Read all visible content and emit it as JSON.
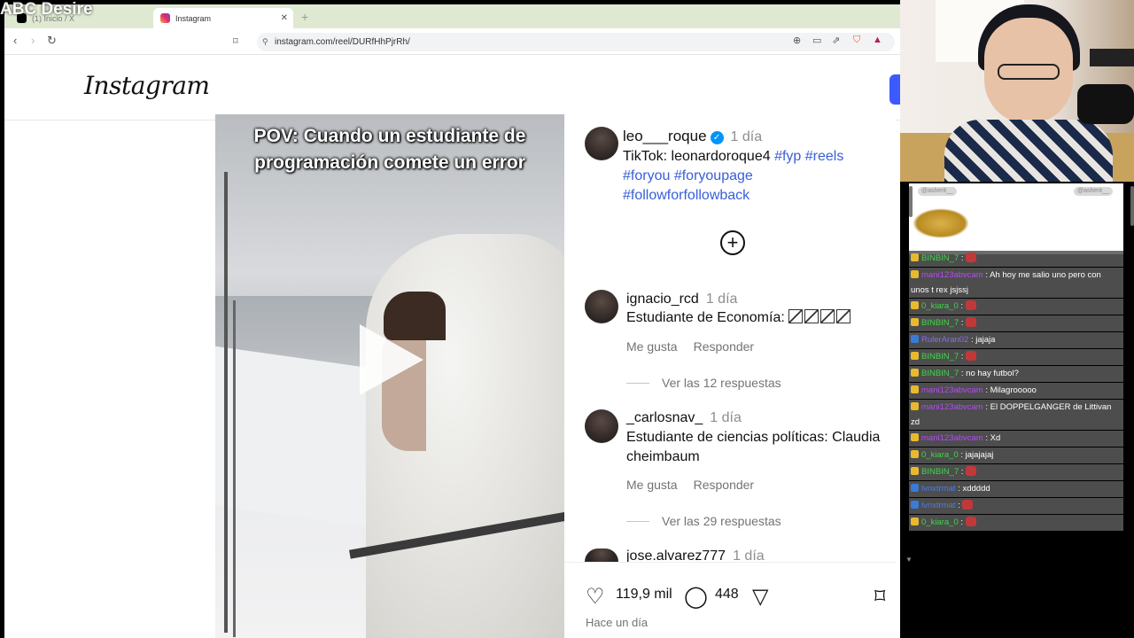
{
  "stream": {
    "overlay_title": "ABC Desire"
  },
  "browser": {
    "tabs": [
      {
        "label": "(1) Inicio / X",
        "active": false
      },
      {
        "label": "Instagram",
        "active": true
      }
    ],
    "url": "instagram.com/reel/DURfHhPjrRh/"
  },
  "instagram": {
    "logo": "Instagram",
    "video": {
      "caption": "POV: Cuando un estudiante de programación comete un error"
    },
    "post": {
      "username": "leo___roque",
      "time": "1 día",
      "caption_text": "TikTok: leonardoroque4 ",
      "hashtags": [
        "#fyp",
        "#reels",
        "#foryou",
        "#foryoupage",
        "#followforfollowback"
      ]
    },
    "comments": [
      {
        "username": "ignacio_rcd",
        "time": "1 día",
        "text": "Estudiante de Economía: ",
        "emoji_count": 4,
        "like_label": "Me gusta",
        "reply_label": "Responder",
        "replies_label": "Ver las 12 respuestas"
      },
      {
        "username": "_carlosnav_",
        "time": "1 día",
        "text": "Estudiante de ciencias políticas: Claudia cheimbaum",
        "like_label": "Me gusta",
        "reply_label": "Responder",
        "replies_label": "Ver las 29 respuestas"
      },
      {
        "username": "jose.alvarez777",
        "time": "1 día"
      }
    ],
    "actions": {
      "likes": "119,9 mil",
      "comments": "448",
      "posted": "Hace un día"
    }
  },
  "chat": {
    "header_pills": [
      "@asherit__",
      "@asherit__"
    ],
    "messages": [
      {
        "user": "BINBIN_7",
        "text": "",
        "color": "#3fd64a",
        "badge": "gold",
        "emote": true
      },
      {
        "user": "mani123abvcam",
        "text": "Ah hoy me salio uno pero con unos t rex jsjssj",
        "color": "#b34df2",
        "badge": "gold"
      },
      {
        "user": "0_kiara_0",
        "text": "",
        "color": "#3fd64a",
        "badge": "gold",
        "emote": true
      },
      {
        "user": "BINBIN_7",
        "text": "",
        "color": "#3fd64a",
        "badge": "gold",
        "emote": true
      },
      {
        "user": "RulerAran02",
        "text": "jajaja",
        "color": "#8a6cf0",
        "badge": "blue"
      },
      {
        "user": "BINBIN_7",
        "text": "",
        "color": "#3fd64a",
        "badge": "gold",
        "emote": true
      },
      {
        "user": "BINBIN_7",
        "text": "no hay futbol?",
        "color": "#3fd64a",
        "badge": "gold"
      },
      {
        "user": "mani123abvcam",
        "text": "Milagrooooo",
        "color": "#b34df2",
        "badge": "gold"
      },
      {
        "user": "mani123abvcam",
        "text": "El DOPPELGANGER de Littivan zd",
        "color": "#b34df2",
        "badge": "gold"
      },
      {
        "user": "mani123abvcam",
        "text": "Xd",
        "color": "#b34df2",
        "badge": "gold"
      },
      {
        "user": "0_kiara_0",
        "text": "jajajajaj",
        "color": "#3fd64a",
        "badge": "gold"
      },
      {
        "user": "BINBIN_7",
        "text": "",
        "color": "#3fd64a",
        "badge": "gold",
        "emote": true
      },
      {
        "user": "lvnxtrmat",
        "text": "xddddd",
        "color": "#4a7bf0",
        "badge": "blue"
      },
      {
        "user": "lvnxtrmat",
        "text": "",
        "color": "#4a7bf0",
        "badge": "blue",
        "emote": true
      },
      {
        "user": "0_kiara_0",
        "text": "",
        "color": "#3fd64a",
        "badge": "gold",
        "emote": true
      }
    ]
  }
}
